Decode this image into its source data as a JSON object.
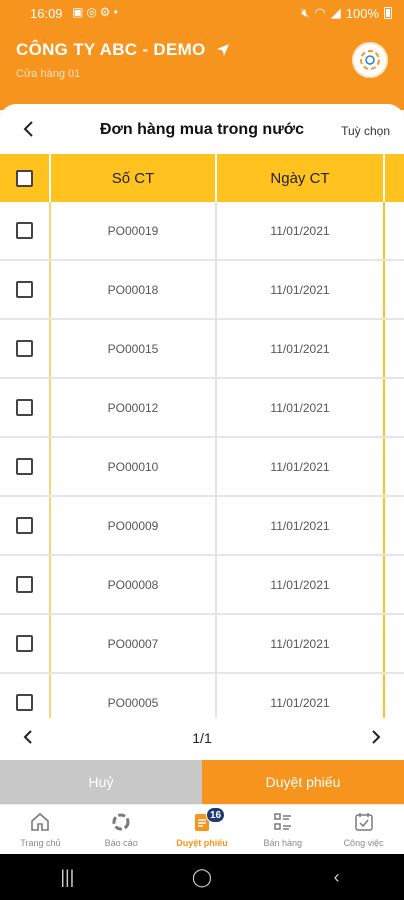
{
  "status_bar": {
    "time": "16:09",
    "battery": "100%"
  },
  "header": {
    "company": "CÔNG TY ABC - DEMO",
    "store": "Cửa hàng 01"
  },
  "page": {
    "title": "Đơn hàng mua trong nước",
    "options": "Tuỳ chọn"
  },
  "table": {
    "columns": [
      "Số CT",
      "Ngày CT"
    ],
    "rows": [
      {
        "so_ct": "PO00019",
        "ngay_ct": "11/01/2021"
      },
      {
        "so_ct": "PO00018",
        "ngay_ct": "11/01/2021"
      },
      {
        "so_ct": "PO00015",
        "ngay_ct": "11/01/2021"
      },
      {
        "so_ct": "PO00012",
        "ngay_ct": "11/01/2021"
      },
      {
        "so_ct": "PO00010",
        "ngay_ct": "11/01/2021"
      },
      {
        "so_ct": "PO00009",
        "ngay_ct": "11/01/2021"
      },
      {
        "so_ct": "PO00008",
        "ngay_ct": "11/01/2021"
      },
      {
        "so_ct": "PO00007",
        "ngay_ct": "11/01/2021"
      },
      {
        "so_ct": "PO00005",
        "ngay_ct": "11/01/2021"
      }
    ]
  },
  "pager": {
    "page": "1/1"
  },
  "actions": {
    "cancel": "Huỷ",
    "approve": "Duyệt phiếu"
  },
  "nav": {
    "items": [
      {
        "label": "Trang chủ",
        "icon": "home-icon"
      },
      {
        "label": "Báo cáo",
        "icon": "report-icon"
      },
      {
        "label": "Duyệt phiếu",
        "icon": "approve-icon",
        "badge": "16"
      },
      {
        "label": "Bán hàng",
        "icon": "sales-icon"
      },
      {
        "label": "Công việc",
        "icon": "task-icon"
      }
    ]
  },
  "colors": {
    "primary": "#f7941d",
    "header_row": "#ffc21e",
    "badge": "#1f3a73",
    "cancel": "#c8c8c8"
  }
}
